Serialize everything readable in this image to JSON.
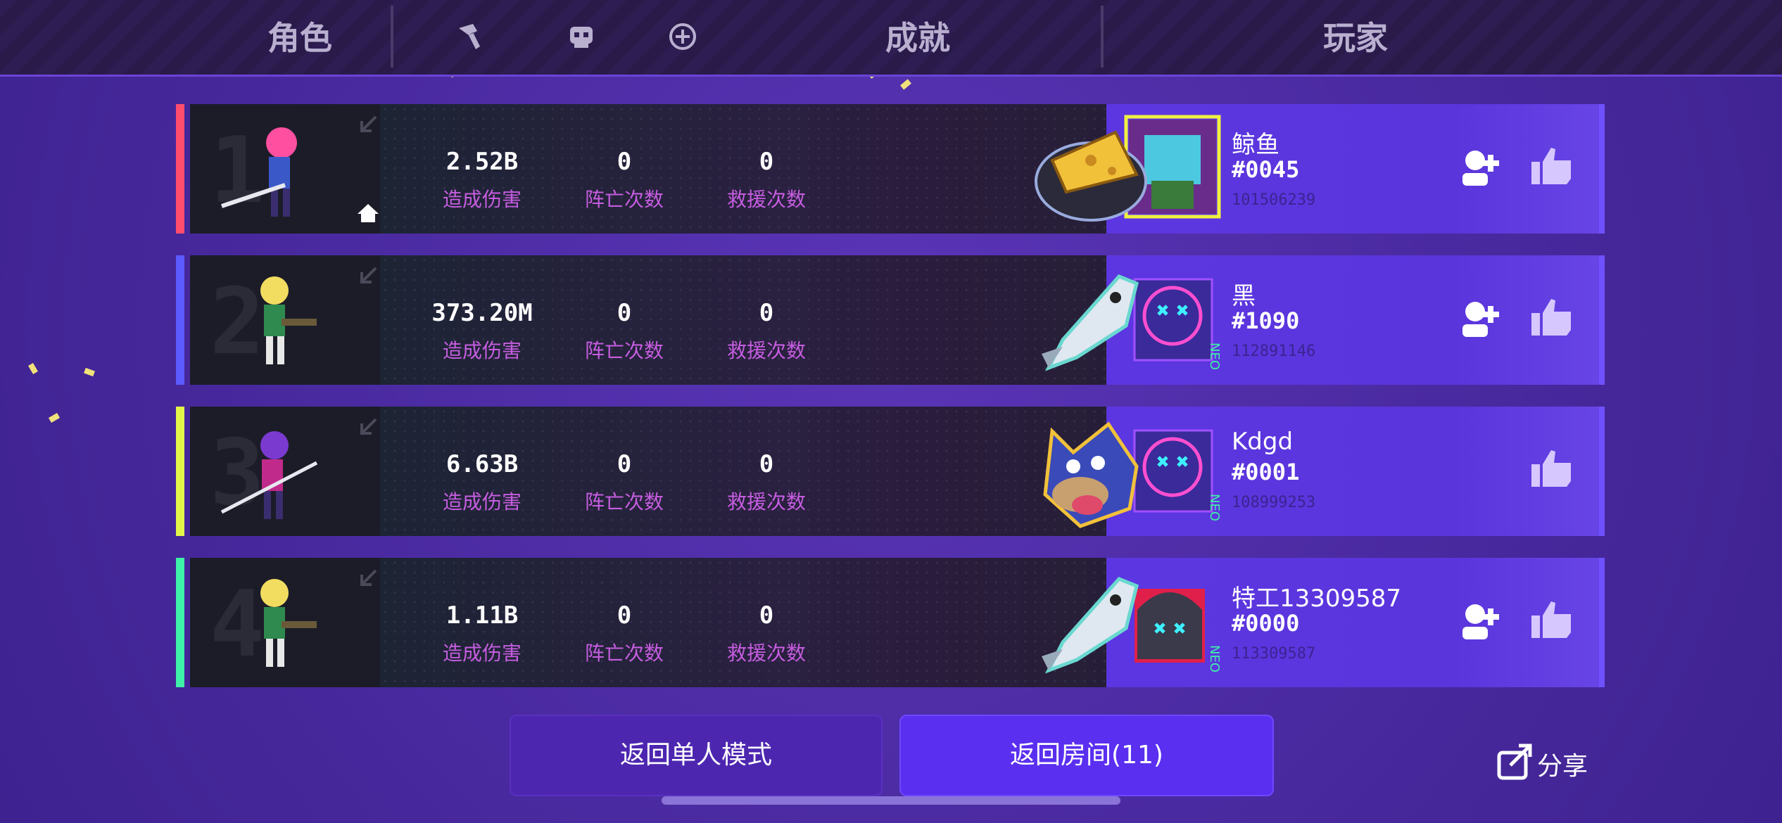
{
  "tabs": {
    "character": "角色",
    "achievements": "成就",
    "players": "玩家"
  },
  "header_icons": [
    "hammer-icon",
    "skull-icon",
    "plus-circle-icon"
  ],
  "stat_labels": {
    "damage": "造成伤害",
    "deaths": "阵亡次数",
    "rescues": "救援次数"
  },
  "rows": [
    {
      "rank": "1",
      "stripe_color": "#ff4d6d",
      "damage": "2.52B",
      "deaths": "0",
      "rescues": "0",
      "achievement_icon": "cheese-icon",
      "player_name": "鲸鱼",
      "player_tag": "#0045",
      "player_id": "101506239",
      "has_add_friend": true,
      "is_host": true
    },
    {
      "rank": "2",
      "stripe_color": "#5b5bff",
      "damage": "373.20M",
      "deaths": "0",
      "rescues": "0",
      "achievement_icon": "fish-icon",
      "player_name": "黑",
      "player_tag": "#1090",
      "player_id": "112891146",
      "has_add_friend": true,
      "is_host": false
    },
    {
      "rank": "3",
      "stripe_color": "#e4f54a",
      "damage": "6.63B",
      "deaths": "0",
      "rescues": "0",
      "achievement_icon": "wolf-icon",
      "player_name": "Kdgd",
      "player_tag": "#0001",
      "player_id": "108999253",
      "has_add_friend": false,
      "is_host": false
    },
    {
      "rank": "4",
      "stripe_color": "#3ef0a8",
      "damage": "1.11B",
      "deaths": "0",
      "rescues": "0",
      "achievement_icon": "fish-icon",
      "player_name": "特工13309587",
      "player_tag": "#0000",
      "player_id": "113309587",
      "has_add_friend": true,
      "is_host": false
    }
  ],
  "buttons": {
    "return_single": "返回单人模式",
    "return_room": "返回房间(11)",
    "share": "分享"
  },
  "colors": {
    "accent": "#5a2ff0",
    "label": "#c65de0",
    "panel": "#1c1c28"
  }
}
